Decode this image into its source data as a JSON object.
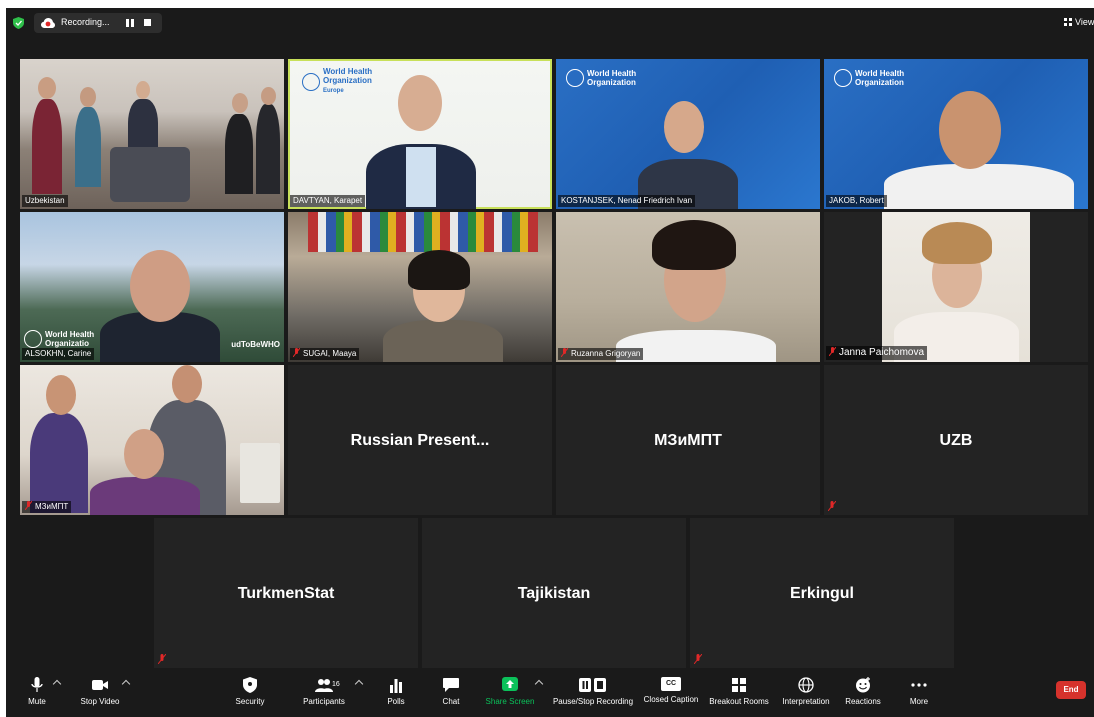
{
  "topbar": {
    "recording_label": "Recording...",
    "view_label": "View"
  },
  "tiles": [
    {
      "name": "Uzbekistan"
    },
    {
      "name": "DAVTYAN, Karapet"
    },
    {
      "name": "KOSTANJSEK, Nenad Friedrich Ivan"
    },
    {
      "name": "JAKOB, Robert"
    },
    {
      "name": "ALSOKHN, Carine"
    },
    {
      "name": "SUGAI, Maaya"
    },
    {
      "name": "Ruzanna Grigoryan"
    },
    {
      "name": "Janna Paichomova"
    },
    {
      "name": "МЗиМПТ"
    },
    {
      "name": "Russian Present..."
    },
    {
      "name": "МЗиМПТ"
    },
    {
      "name": "UZB"
    },
    {
      "name": "TurkmenStat"
    },
    {
      "name": "Tajikistan"
    },
    {
      "name": "Erkingul"
    }
  ],
  "overlay_text": {
    "who_line1": "World Health",
    "who_line2": "Organization",
    "who_europe": "Europe",
    "who_truncated": "Organizatio",
    "hashtag": "udToBeWHO"
  },
  "toolbar": {
    "mute": "Mute",
    "stop_video": "Stop Video",
    "security": "Security",
    "participants": "Participants",
    "participants_count": "16",
    "polls": "Polls",
    "chat": "Chat",
    "share_screen": "Share Screen",
    "pause_stop_recording": "Pause/Stop Recording",
    "closed_caption": "Closed Caption",
    "breakout_rooms": "Breakout Rooms",
    "interpretation": "Interpretation",
    "reactions": "Reactions",
    "more": "More",
    "end": "End",
    "cc_icon_text": "CC"
  },
  "colors": {
    "active_speaker_border": "#c8e05a",
    "share_screen_green": "#0bc15a",
    "end_red": "#d6322c",
    "shield_green": "#2fbf4a",
    "record_red": "#e02828",
    "mute_red": "#e02828"
  },
  "icons": {
    "mute": "microphone-icon",
    "video": "video-camera-icon",
    "security": "shield-icon",
    "participants": "people-icon",
    "polls": "bar-chart-icon",
    "chat": "chat-bubble-icon",
    "share": "share-arrow-icon",
    "record": "pause-stop-icon",
    "cc": "cc-icon",
    "breakout": "grid-icon",
    "interpretation": "globe-icon",
    "reactions": "smiley-icon",
    "more": "ellipsis-icon"
  }
}
